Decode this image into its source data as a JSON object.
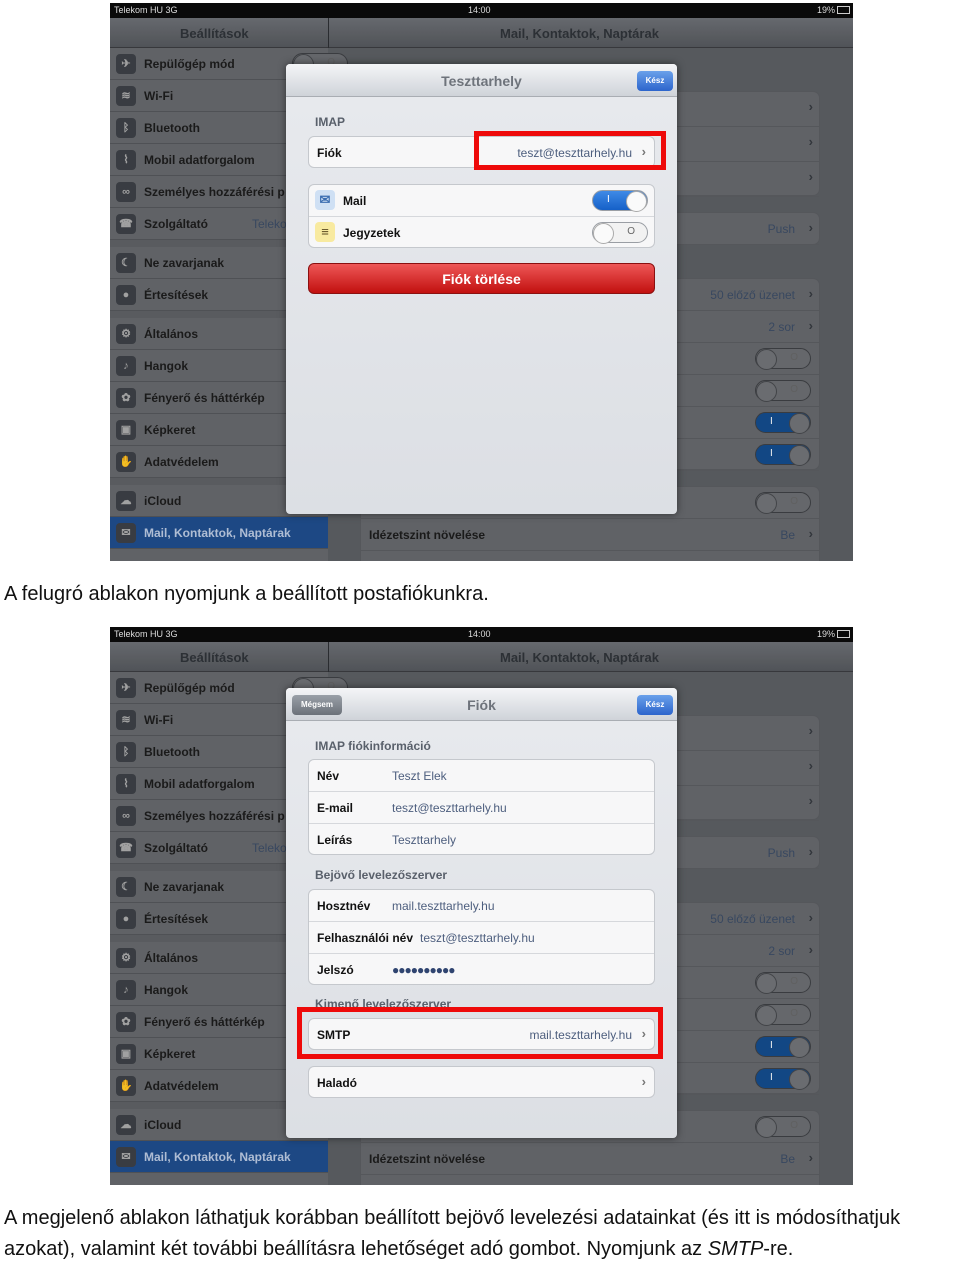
{
  "ipad": {
    "status": {
      "carrier": "Telekom HU  3G",
      "time": "14:00",
      "battery": "19%"
    },
    "left_title": "Beállítások",
    "right_title": "Mail, Kontaktok, Naptárak",
    "sidebar": [
      {
        "label": "Repülőgép mód",
        "icon": "airplane-icon",
        "toggle": "off"
      },
      {
        "label": "Wi-Fi",
        "icon": "wifi-icon"
      },
      {
        "label": "Bluetooth",
        "icon": "bluetooth-icon"
      },
      {
        "label": "Mobil adatforgalom",
        "icon": "cellular-icon"
      },
      {
        "label": "Személyes hozzáférési p",
        "icon": "hotspot-icon"
      },
      {
        "label": "Szolgáltató",
        "icon": "phone-icon",
        "value": "Telekom"
      },
      {
        "label": "Ne zavarjanak",
        "icon": "moon-icon",
        "toggle": "off"
      },
      {
        "label": "Értesítések",
        "icon": "notifications-icon"
      },
      {
        "label": "Általános",
        "icon": "gear-icon"
      },
      {
        "label": "Hangok",
        "icon": "speaker-icon"
      },
      {
        "label": "Fényerő és háttérkép",
        "icon": "flower-icon"
      },
      {
        "label": "Képkeret",
        "icon": "picture-frame-icon"
      },
      {
        "label": "Adatvédelem",
        "icon": "hand-icon"
      },
      {
        "label": "iCloud",
        "icon": "cloud-icon"
      },
      {
        "label": "Mail, Kontaktok, Naptárak",
        "icon": "mail-icon",
        "selected": true
      }
    ],
    "right_rows": {
      "push": "Push",
      "preview": "50 előző üzenet",
      "lines": "2 sor",
      "toggles": [
        "off",
        "off",
        "on",
        "on",
        "off"
      ],
      "quote_label": "Idézetszint növelése",
      "quote_value": "Be"
    },
    "toggle_on_text": "I",
    "toggle_off_text": "O"
  },
  "popup1": {
    "title": "Teszttarhely",
    "done": "Kész",
    "section": "IMAP",
    "account_label": "Fiók",
    "account_value": "teszt@teszttarhely.hu",
    "services": [
      {
        "label": "Mail",
        "icon": "mail-icon",
        "toggle": "on"
      },
      {
        "label": "Jegyzetek",
        "icon": "notes-icon",
        "toggle": "off"
      }
    ],
    "delete": "Fiók törlése",
    "highlight_color": "#ee0a0a"
  },
  "caption1": "A felugró ablakon nyomjunk a beállított postafiókunkra.",
  "popup2": {
    "title": "Fiók",
    "cancel": "Mégsem",
    "done": "Kész",
    "section1": "IMAP fiókinformáció",
    "info": [
      {
        "label": "Név",
        "value": "Teszt Elek"
      },
      {
        "label": "E-mail",
        "value": "teszt@teszttarhely.hu"
      },
      {
        "label": "Leírás",
        "value": "Teszttarhely"
      }
    ],
    "section2": "Bejövő levelezőszerver",
    "incoming": [
      {
        "label": "Hosztnév",
        "value": "mail.teszttarhely.hu"
      },
      {
        "label": "Felhasználói név",
        "value": "teszt@teszttarhely.hu"
      },
      {
        "label": "Jelszó",
        "value": "●●●●●●●●●●"
      }
    ],
    "section3": "Kimenő levelezőszerver",
    "smtp_label": "SMTP",
    "smtp_value": "mail.teszttarhely.hu",
    "advanced": "Haladó"
  },
  "caption2_line1": "A megjelenő ablakon láthatjuk korábban beállított bejövő levelezési adatainkat (és itt is módosíthatjuk",
  "caption2_line2_a": "azokat), valamint két további beállításra lehetőséget adó gombot. Nyomjunk az ",
  "caption2_line2_em": "SMTP",
  "caption2_line2_b": "-re."
}
